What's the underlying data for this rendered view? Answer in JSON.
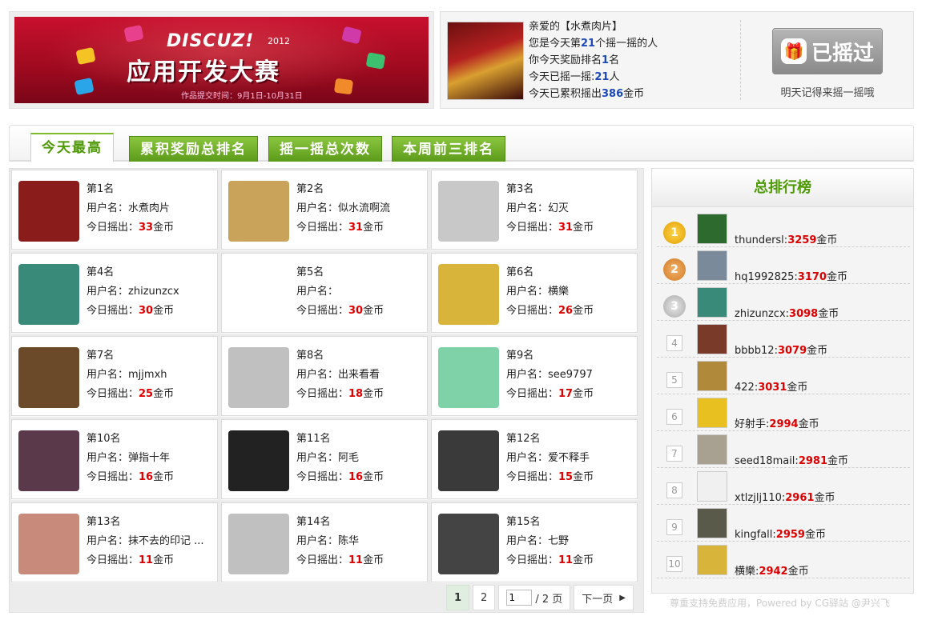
{
  "banner": {
    "logo": "DISCUZ!",
    "year": "2012",
    "title": "应用开发大赛",
    "subtitle": "作品提交时间：9月1日-10月31日"
  },
  "user_info": {
    "line1": "亲爱的【水煮肉片】",
    "line2_pre": "您是今天第",
    "line2_num": "21",
    "line2_post": "个摇一摇的人",
    "line3_pre": "你今天奖励排名",
    "line3_num": "1",
    "line3_post": "名",
    "line4_pre": "今天已摇一摇:",
    "line4_num": "21",
    "line4_post": "人",
    "line5_pre": "今天已累积摇出",
    "line5_num": "386",
    "line5_post": "金币",
    "shake_button": "已摇过",
    "gift_icon": "gift-icon",
    "shake_note": "明天记得来摇一摇哦"
  },
  "tabs": [
    "今天最高",
    "累积奖励总排名",
    "摇一摇总次数",
    "本周前三排名"
  ],
  "labels": {
    "username": "用户名：",
    "today": "今日摇出：",
    "coin": "金币"
  },
  "cards": [
    {
      "rank": "第1名",
      "user": "水煮肉片",
      "coins": "33",
      "color": "#8b1c1c"
    },
    {
      "rank": "第2名",
      "user": "似水流啊流",
      "coins": "31",
      "color": "#c9a35a"
    },
    {
      "rank": "第3名",
      "user": "幻灭",
      "coins": "31",
      "color": "#c8c8c8"
    },
    {
      "rank": "第4名",
      "user": "zhizunzcx",
      "coins": "30",
      "color": "#3a8a7a"
    },
    {
      "rank": "第5名",
      "user": "",
      "coins": "30",
      "color": "#ffffff"
    },
    {
      "rank": "第6名",
      "user": "横樂",
      "coins": "26",
      "color": "#d8b43a"
    },
    {
      "rank": "第7名",
      "user": "mjjmxh",
      "coins": "25",
      "color": "#6b4a2a"
    },
    {
      "rank": "第8名",
      "user": "出来看看",
      "coins": "18",
      "color": "#c0c0c0"
    },
    {
      "rank": "第9名",
      "user": "see9797",
      "coins": "17",
      "color": "#7fd1a8"
    },
    {
      "rank": "第10名",
      "user": "弹指十年",
      "coins": "16",
      "color": "#5a3a4a"
    },
    {
      "rank": "第11名",
      "user": "阿毛",
      "coins": "16",
      "color": "#222222"
    },
    {
      "rank": "第12名",
      "user": "爱不释手",
      "coins": "15",
      "color": "#3a3a3a"
    },
    {
      "rank": "第13名",
      "user": "抹不去的印记 ...",
      "coins": "11",
      "color": "#c88a7a"
    },
    {
      "rank": "第14名",
      "user": "陈华",
      "coins": "11",
      "color": "#c0c0c0"
    },
    {
      "rank": "第15名",
      "user": "七野",
      "coins": "11",
      "color": "#444444"
    }
  ],
  "pager": {
    "page1": "1",
    "page2": "2",
    "input_value": "1",
    "total": "/ 2 页",
    "next": "下一页"
  },
  "credit": "尊重支持免费应用，Powered by CG驿站 @尹兴飞",
  "leaderboard": {
    "title": "总排行榜",
    "rows": [
      {
        "n": "1",
        "name": "thundersl",
        "coins": "3259",
        "color": "#2d6a2d"
      },
      {
        "n": "2",
        "name": "hq1992825",
        "coins": "3170",
        "color": "#7a8a9a"
      },
      {
        "n": "3",
        "name": "zhizunzcx",
        "coins": "3098",
        "color": "#3a8a7a"
      },
      {
        "n": "4",
        "name": "bbbb12",
        "coins": "3079",
        "color": "#7a3a2a"
      },
      {
        "n": "5",
        "name": "422",
        "coins": "3031",
        "color": "#b08a3a"
      },
      {
        "n": "6",
        "name": "好射手",
        "coins": "2994",
        "color": "#e8c020"
      },
      {
        "n": "7",
        "name": "seed18mail",
        "coins": "2981",
        "color": "#a8a090"
      },
      {
        "n": "8",
        "name": "xtlzjlj110",
        "coins": "2961",
        "color": "#f0f0f0"
      },
      {
        "n": "9",
        "name": "kingfall",
        "coins": "2959",
        "color": "#5a5a4a"
      },
      {
        "n": "10",
        "name": "横樂",
        "coins": "2942",
        "color": "#d8b43a"
      }
    ]
  }
}
